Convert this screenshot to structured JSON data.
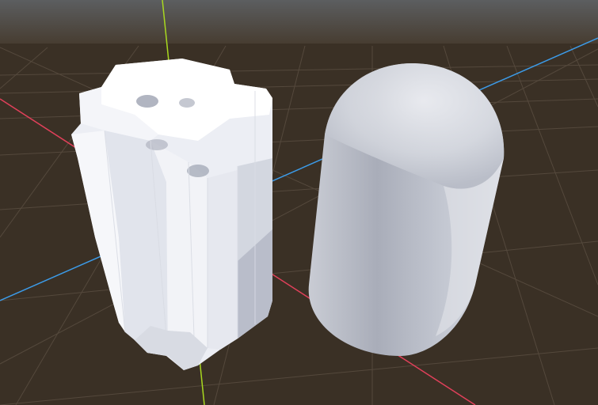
{
  "scene": {
    "kind": "3d-viewport",
    "sky_color": "#5c5e60",
    "ground_color": "#3a3025",
    "grid_color": "#6b5f52",
    "axes": {
      "x": {
        "color": "#e0405a"
      },
      "y": {
        "color": "#a8d81f"
      },
      "z": {
        "color": "#3c9be8"
      }
    },
    "objects": [
      {
        "name": "voxel-capsule",
        "color": "#eef0f6"
      },
      {
        "name": "smooth-capsule",
        "color": "#d6d9e1"
      }
    ]
  }
}
